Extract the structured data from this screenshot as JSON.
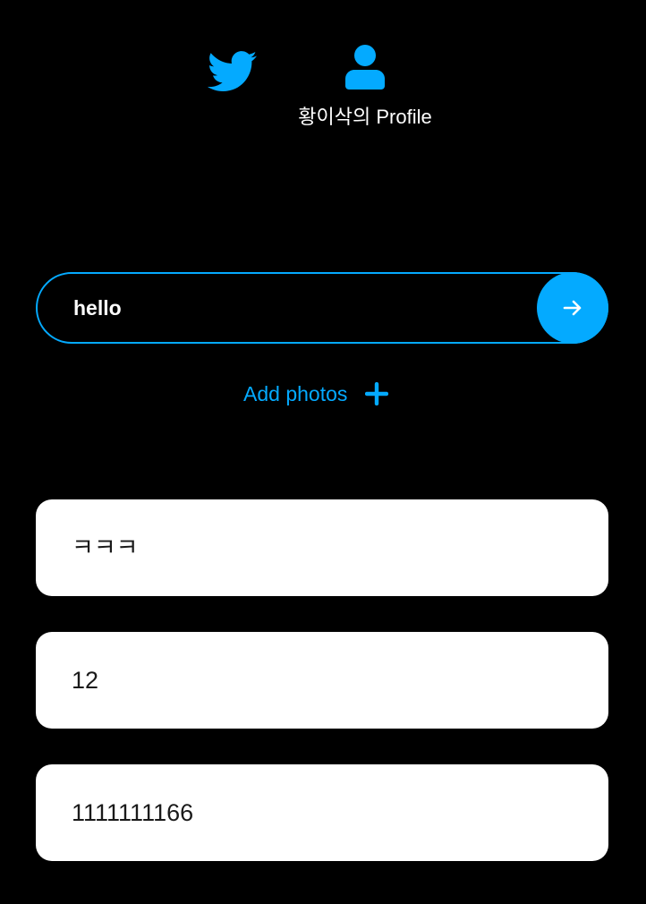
{
  "nav": {
    "home_icon": "twitter-bird-icon",
    "profile_icon": "user-icon",
    "profile_label": "황이삭의 Profile"
  },
  "composer": {
    "input_value": "hello",
    "submit_icon": "arrow-right-icon"
  },
  "add_photos": {
    "label": "Add photos",
    "icon": "plus-icon"
  },
  "tweets": [
    {
      "text": "ㅋㅋㅋ"
    },
    {
      "text": "12"
    },
    {
      "text": "1111111166"
    }
  ],
  "colors": {
    "background": "#000000",
    "accent": "#04aaff",
    "card": "#ffffff",
    "card_text": "#1a1a1a"
  }
}
